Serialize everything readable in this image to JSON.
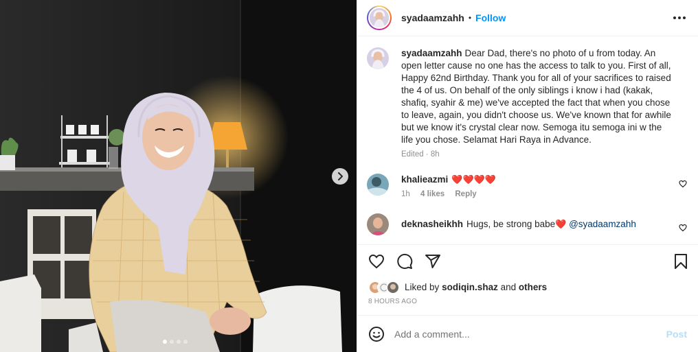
{
  "header": {
    "username": "syadaamzahh",
    "separator": "•",
    "follow_label": "Follow"
  },
  "caption": {
    "username": "syadaamzahh",
    "text": "Dear Dad, there's no photo of u from today. An open letter cause no one has the access to talk to you. First of all, Happy 62nd Birthday. Thank you for all of your sacrifices to raised the 4 of us. On behalf of the only siblings i know i had (kakak, shafiq, syahir & me) we've accepted the fact that when you chose to leave, again, you didn't choose us. We've known that for awhile but we know it's crystal clear now. Semoga itu semoga ini w the life you chose. Selamat Hari Raya in Advance.",
    "edited": "Edited · 8h"
  },
  "comments": [
    {
      "username": "khalieazmi",
      "text": "❤️❤️❤️❤️",
      "time": "1h",
      "likes": "4 likes",
      "reply_label": "Reply"
    },
    {
      "username": "deknasheikhh",
      "text": "Hugs, be strong babe",
      "heart": "❤️",
      "mention": "@syadaamzahh"
    }
  ],
  "likes": {
    "prefix": "Liked by",
    "user": "sodiqin.shaz",
    "and": "and",
    "others": "others"
  },
  "timestamp": "8 HOURS AGO",
  "add_comment": {
    "placeholder": "Add a comment...",
    "post_label": "Post"
  },
  "carousel": {
    "slide_count": 4,
    "active_index": 0
  },
  "colors": {
    "link_blue": "#0095f6",
    "post_disabled": "#b2dffc",
    "muted": "#8e8e8e",
    "heart_red": "#ed1c24",
    "mention": "#00376b"
  },
  "icons": [
    "heart-icon",
    "comment-icon",
    "share-icon",
    "bookmark-icon",
    "emoji-icon",
    "more-icon",
    "chevron-right-icon"
  ]
}
